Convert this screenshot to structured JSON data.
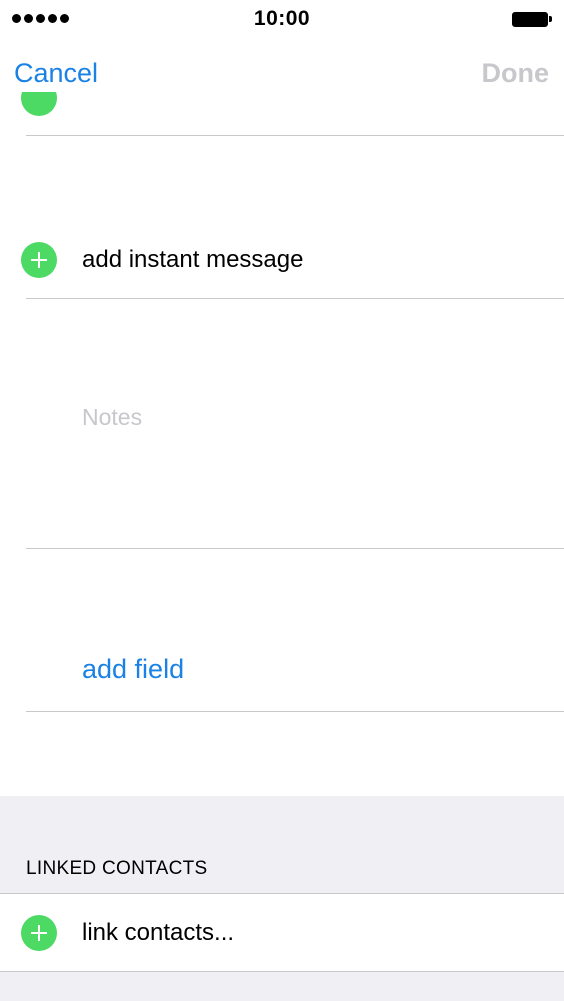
{
  "status_bar": {
    "signal_dots": 5,
    "time": "10:00",
    "battery_level": 1.0
  },
  "nav": {
    "cancel_label": "Cancel",
    "done_label": "Done"
  },
  "rows": {
    "instant_message_label": "add instant message",
    "notes_placeholder": "Notes",
    "add_field_label": "add field"
  },
  "linked_contacts": {
    "header": "LINKED CONTACTS",
    "link_label": "link contacts..."
  },
  "colors": {
    "accent": "#1a82e5",
    "add_green": "#4cd964",
    "disabled": "#c7c7cc",
    "separator": "#c8c7cc",
    "section_bg": "#efeff4"
  }
}
